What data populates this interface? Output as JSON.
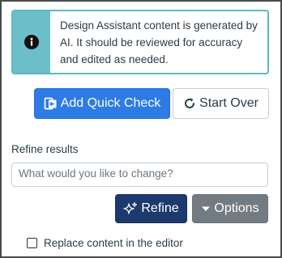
{
  "alert": {
    "icon": "info-icon",
    "message": "Design Assistant content is generated by AI. It should be reviewed for accuracy and edited as needed."
  },
  "actions": {
    "add_quick_check_label": "Add Quick Check",
    "start_over_label": "Start Over"
  },
  "refine": {
    "label": "Refine results",
    "placeholder": "What would you like to change?",
    "value": "",
    "refine_button_label": "Refine",
    "options_button_label": "Options"
  },
  "replace": {
    "label": "Replace content in the editor",
    "checked": false
  },
  "colors": {
    "alert_accent": "#6cbec9",
    "primary": "#2d7be4",
    "refine": "#1c3a6e",
    "options": "#737b82"
  }
}
